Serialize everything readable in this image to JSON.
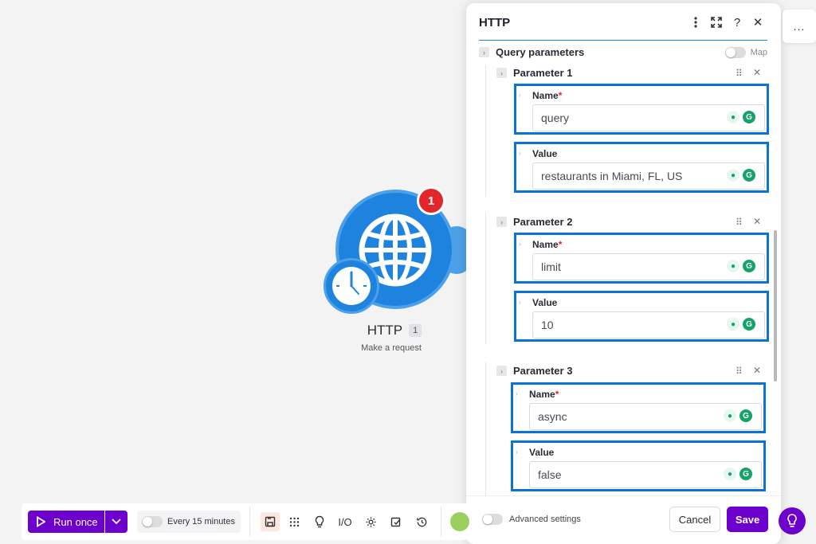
{
  "canvas": {
    "module": {
      "name": "HTTP",
      "number": "1",
      "subtitle": "Make a request",
      "badge_count": "1",
      "color": "#1d83df",
      "icon": "globe-icon",
      "trigger_icon": "clock-icon"
    }
  },
  "panel": {
    "title": "HTTP",
    "header_icons": [
      "more-vertical-icon",
      "expand-icon",
      "help-icon",
      "close-icon"
    ],
    "query_parameters": {
      "label": "Query parameters",
      "map_label": "Map"
    },
    "parameters": [
      {
        "label": "Parameter 1",
        "name_label": "Name",
        "name_value": "query",
        "value_label": "Value",
        "value_value": "restaurants in Miami, FL, US"
      },
      {
        "label": "Parameter 2",
        "name_label": "Name",
        "name_value": "limit",
        "value_label": "Value",
        "value_value": "10"
      },
      {
        "label": "Parameter 3",
        "name_label": "Name",
        "name_value": "async",
        "value_label": "Value",
        "value_value": "false"
      }
    ],
    "required_marker": "*",
    "footer": {
      "advanced_settings_label": "Advanced settings",
      "cancel_label": "Cancel",
      "save_label": "Save"
    }
  },
  "toolbar": {
    "run_once_label": "Run once",
    "schedule_label": "Every 15 minutes",
    "io_label": "I/O",
    "tools": [
      "save-icon",
      "grid-icon",
      "bulb-icon",
      "io-icon",
      "gear-icon",
      "notes-icon",
      "history-icon"
    ]
  },
  "top_right": {
    "more_label": "..."
  },
  "colors": {
    "accent": "#6d00cc",
    "highlight": "#0b72d9",
    "module": "#1d83df",
    "badge": "#e3262b",
    "grammarly": "#15a36a"
  }
}
